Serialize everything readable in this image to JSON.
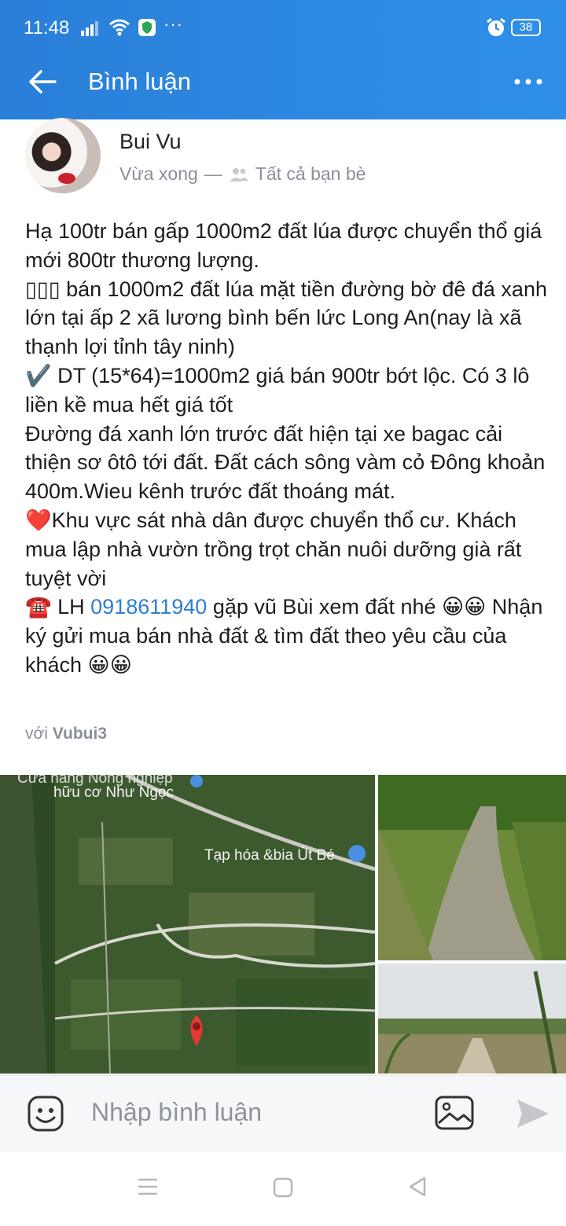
{
  "status_bar": {
    "time": "11:48",
    "dots": "···",
    "battery": "38",
    "icons": [
      "signal-icon",
      "wifi-icon",
      "vpn-shield-icon",
      "alarm-icon",
      "battery-icon"
    ]
  },
  "app_bar": {
    "title": "Bình luận",
    "back_icon": "arrow-left-icon",
    "menu_icon": "more-dots-icon"
  },
  "post": {
    "author": "Bui Vu",
    "time": "Vừa xong",
    "separator": "—",
    "privacy": "Tất cả bạn bè",
    "body_before_phone": "Hạ 100tr bán gấp 1000m2 đất lúa được chuyển thổ giá mới 800tr thương lượng.\n▯▯▯ bán 1000m2 đất lúa mặt tiền đường bờ đê đá xanh lớn tại ấp 2 xã lương bình bến lức Long An(nay là xã thạnh lợi tỉnh tây ninh)\n✔️ DT (15*64)=1000m2 giá bán 900tr bớt lộc. Có 3 lô liền kề mua hết giá tốt\nĐường đá xanh lớn trước đất hiện tại xe bagac cải thiện sơ ôtô tới đất. Đất cách sông vàm cỏ Đông khoản 400m.Wieu kênh trước đất thoáng mát.\n❤️Khu vực sát nhà dân được chuyển thổ cư. Khách mua lập nhà vườn trồng trọt chăn nuôi dưỡng già rất tuyệt vời\n☎️ LH ",
    "phone": "0918611940",
    "body_after_phone": " gặp vũ Bùi xem đất nhé 😀😀 Nhận ký gửi mua bán nhà đất & tìm đất theo yêu cầu của khách 😀😀",
    "with_prefix": "với",
    "tagged": "Vubui3"
  },
  "gallery": {
    "map_label_1a": "Cửa hàng Nông nghiệp",
    "map_label_1b": "hữu cơ Như Ngọc",
    "map_label_2": "Tạp hóa &bia Út Bé"
  },
  "composer": {
    "placeholder": "Nhập bình luận"
  },
  "colors": {
    "header_blue": "#2a7fd8",
    "link_blue": "#2d7fd4",
    "muted_gray": "#8a8f98"
  }
}
